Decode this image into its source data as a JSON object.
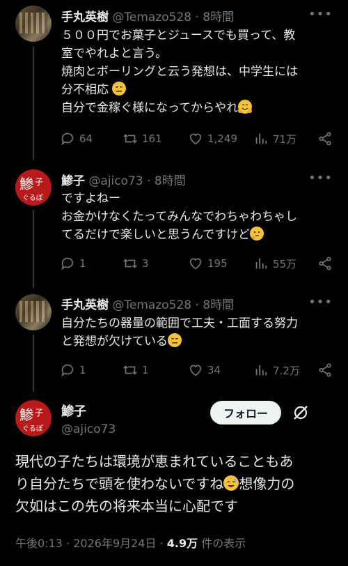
{
  "tweets": [
    {
      "name": "手丸英樹",
      "handle": "@Temazo528",
      "sep": "·",
      "time": "8時間",
      "lines": [
        "５００円でお菓子とジュースでも買って、教",
        "室でやれよと言う。",
        "焼肉とボーリングと云う発想は、中学生には",
        "分不相応",
        "自分で金稼ぐ様になってからやれ"
      ],
      "replies": "64",
      "reposts": "161",
      "likes": "1,249",
      "views": "71万"
    },
    {
      "name": "鯵子",
      "handle": "@ajico73",
      "sep": "·",
      "time": "8時間",
      "lines": [
        "ですよねー",
        "お金かけなくたってみんなでわちゃわちゃし",
        "てるだけで楽しいと思うんですけど"
      ],
      "replies": "1",
      "reposts": "3",
      "likes": "195",
      "views": "55万"
    },
    {
      "name": "手丸英樹",
      "handle": "@Temazo528",
      "sep": "·",
      "time": "8時間",
      "lines": [
        "自分たちの器量の範囲で工夫・工面する努力",
        "と発想が欠けている"
      ],
      "replies": "1",
      "reposts": "1",
      "likes": "34",
      "views": "7.2万"
    }
  ],
  "main": {
    "name": "鯵子",
    "handle": "@ajico73",
    "follow_label": "フォロー",
    "lines": [
      "現代の子たちは環境が恵まれていることもあ",
      "り自分たちで頭を使わないですね",
      "想像力の",
      "欠如はこの先の将来本当に心配です"
    ],
    "time": "午後0:13",
    "sep": "·",
    "date": "2026年9月24日",
    "views_count": "4.9万",
    "views_label": "件の表示"
  },
  "avatar_logo_text": "鯵子ぐるぽ",
  "icons": {
    "reply": "reply-icon",
    "repost": "repost-icon",
    "like": "heart-icon",
    "views": "views-icon",
    "share": "share-icon",
    "more": "more-icon",
    "grok": "grok-icon"
  },
  "colors": {
    "background": "#000000",
    "text": "#e7e9ea",
    "muted": "#71767b",
    "avatar_red": "#b81a1a",
    "follow_bg": "#eff3f4"
  }
}
